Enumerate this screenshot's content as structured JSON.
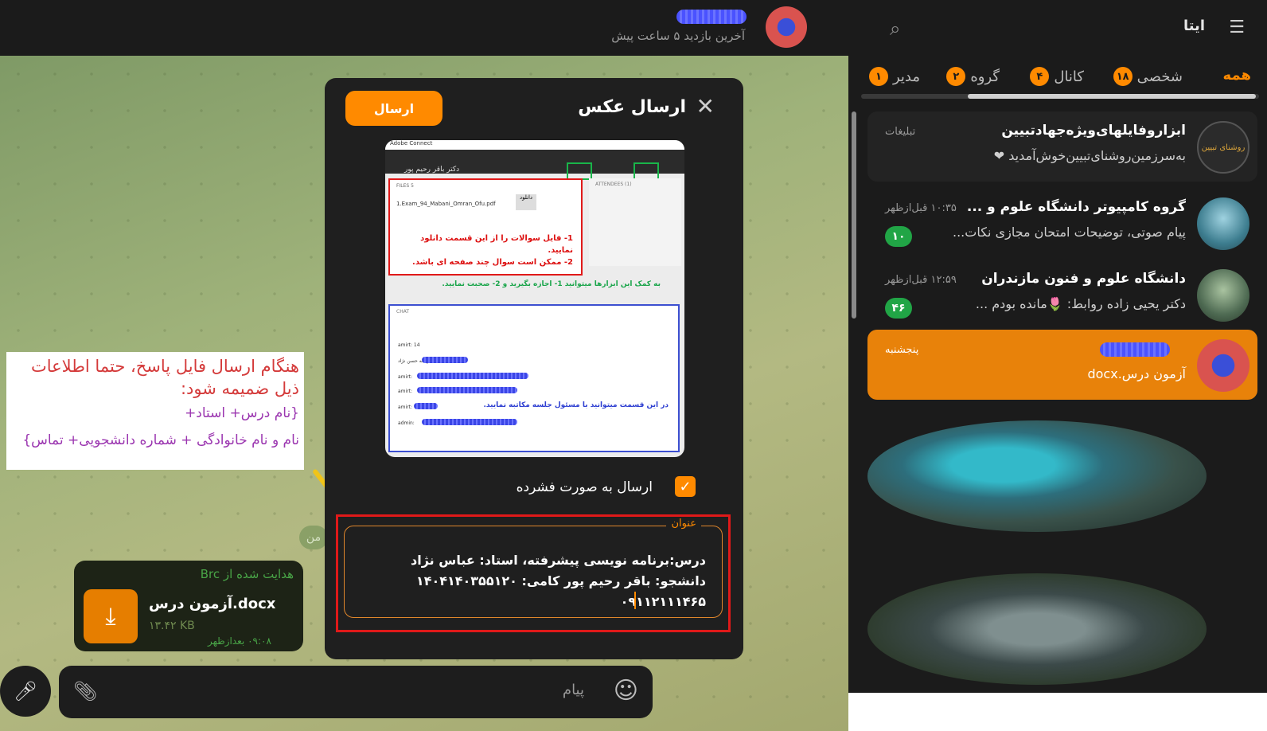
{
  "header": {
    "last_seen": "آخرین بازدید ۵ ساعت پیش"
  },
  "annotation": {
    "line1": "هنگام ارسال فایل پاسخ، حتما اطلاعات",
    "line2": "ذیل ضمیمه شود:",
    "line3": "{نام درس+ استاد+",
    "line4": "نام و نام خانوادگی + شماره دانشجویی+ تماس}"
  },
  "message_bubble": {
    "forwarded_from": "هدایت شده از Brc",
    "file_name": "آزمون درس.docx",
    "file_size": "۱۳.۴۲ KB",
    "time": "۰۹:۰۸ بعدازظهر"
  },
  "small_pill": "من",
  "composer": {
    "placeholder": "پیام"
  },
  "modal": {
    "title": "ارسال عکس",
    "send_label": "ارسال",
    "compress_label": "ارسال به صورت فشرده",
    "caption_legend": "عنوان",
    "caption_text": "درس:برنامه نویسی پیشرفته، استاد: عباس نژاد\nدانشجو: باقر رحیم پور کامی: ۱۴۰۴۱۴۰۳۵۵۱۲۰\n۰۹۱۱۲۱۱۱۴۶۵"
  },
  "preview_image": {
    "app_title": "Adobe Connect",
    "presenter": "دکتر باقر رحیم پور",
    "files_header": "FILES 5",
    "file_item": "1.Exam_94_Mabani_Omran_Ofu.pdf",
    "download_label": "دانلود",
    "red_note_1": "1- فایل سوالات را از این قسمت دانلود نمایید.",
    "red_note_2": "2- ممکن است سوال چند صفحه ای باشد.",
    "attendees_header": "ATTENDEES (1)",
    "green_note": "به کمک این ابزارها میتوانید 1- اجازه بگیرید و 2- صحبت نمایید.",
    "chat_header": "CHAT",
    "chat_row_1": "amirt: 14",
    "chat_row_2": "فهیمه حسن نژاد",
    "chat_row_3": "amirt:",
    "chat_row_4": "amirt:",
    "chat_row_5": "amirt:",
    "chat_row_6": "admin:",
    "blue_note": "در این قسمت میتوانید با مسئول جلسه مکاتبه نمایید."
  },
  "sidebar": {
    "app_name": "ایتا",
    "tabs": [
      {
        "label": "همه",
        "count": ""
      },
      {
        "label": "شخصی",
        "count": "۱۸"
      },
      {
        "label": "کانال",
        "count": "۴"
      },
      {
        "label": "گروه",
        "count": "۲"
      },
      {
        "label": "مدیر",
        "count": "۱"
      }
    ],
    "chats": [
      {
        "name": "ابزاروفایلهای‌ویژه‌جهادتبیین",
        "preview": "به‌سرزمین‌روشنای‌تبیین‌خوش‌آمدید ❤",
        "time": "تبلیغات",
        "badge": "",
        "avatar_text": "روشنای تبیین"
      },
      {
        "name": "گروه کامپیوتر دانشگاه علوم و ...",
        "preview": "پیام صوتی، توضیحات امتحان مجازی نکات...",
        "time": "۱۰:۳۵ قبل‌ازظهر",
        "badge": "۱۰"
      },
      {
        "name": "دانشگاه علوم و فنون مازندران",
        "preview": "دکتر یحیی زاده روابط: 🌷مانده بودم ...",
        "time": "۱۲:۵۹ قبل‌ازظهر",
        "badge": "۴۶"
      },
      {
        "name": "",
        "preview": "آزمون درس.docx",
        "time": "پنجشنبه",
        "badge": ""
      }
    ]
  },
  "colors": {
    "accent": "#ff8a00",
    "badge_green": "#21a546",
    "annotation_red": "#d43a3a",
    "annotation_purple": "#9b36b0"
  }
}
